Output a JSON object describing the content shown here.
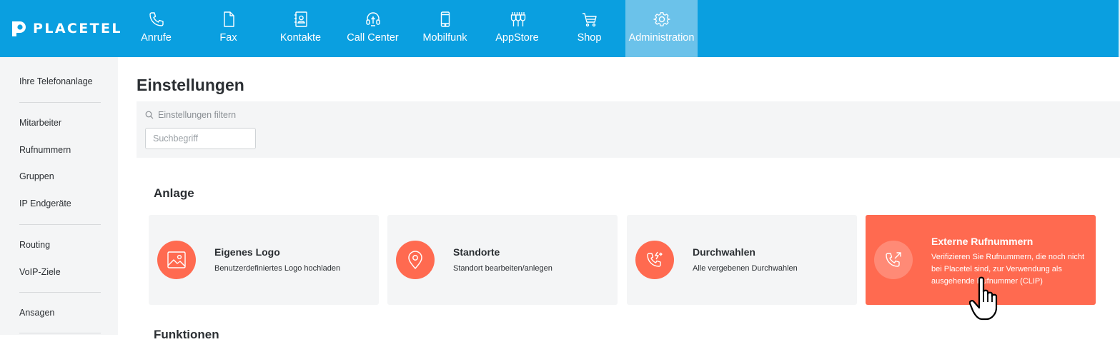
{
  "brand": {
    "name": "PLACETEL"
  },
  "nav": {
    "items": [
      {
        "label": "Anrufe",
        "icon": "phone-icon"
      },
      {
        "label": "Fax",
        "icon": "fax-document-icon"
      },
      {
        "label": "Kontakte",
        "icon": "contacts-book-icon"
      },
      {
        "label": "Call Center",
        "icon": "headset-icon"
      },
      {
        "label": "Mobilfunk",
        "icon": "mobile-phone-icon"
      },
      {
        "label": "AppStore",
        "icon": "plugins-icon"
      },
      {
        "label": "Shop",
        "icon": "shopping-cart-icon"
      },
      {
        "label": "Administration",
        "icon": "gear-icon"
      }
    ],
    "active": "Administration"
  },
  "sidebar": {
    "items": [
      {
        "label": "Ihre Telefonanlage"
      },
      {
        "label": "Mitarbeiter"
      },
      {
        "label": "Rufnummern"
      },
      {
        "label": "Gruppen"
      },
      {
        "label": "IP Endgeräte"
      },
      {
        "label": "Routing"
      },
      {
        "label": "VoIP-Ziele"
      },
      {
        "label": "Ansagen"
      }
    ]
  },
  "main": {
    "title": "Einstellungen",
    "filter": {
      "label": "Einstellungen filtern",
      "placeholder": "Suchbegriff",
      "value": ""
    },
    "sections": [
      {
        "title": "Anlage",
        "cards": [
          {
            "title": "Eigenes Logo",
            "description": "Benutzerdefiniertes Logo hochladen",
            "icon": "image-icon"
          },
          {
            "title": "Standorte",
            "description": "Standort bearbeiten/anlegen",
            "icon": "location-pin-icon"
          },
          {
            "title": "Durchwahlen",
            "description": "Alle vergebenen Durchwahlen",
            "icon": "phone-forward-icon"
          },
          {
            "title": "Externe Rufnummern",
            "description": "Verifizieren Sie Rufnummern, die noch nicht bei Placetel sind, zur Verwendung als ausgehende Rufnummer (CLIP)",
            "icon": "phone-outgoing-icon",
            "highlighted": true
          }
        ]
      },
      {
        "title": "Funktionen"
      }
    ]
  },
  "colors": {
    "brand_blue": "#0a9fe0",
    "active_nav": "#6bc2ea",
    "accent_coral": "#ff6a50",
    "panel_gray": "#f4f5f6"
  }
}
